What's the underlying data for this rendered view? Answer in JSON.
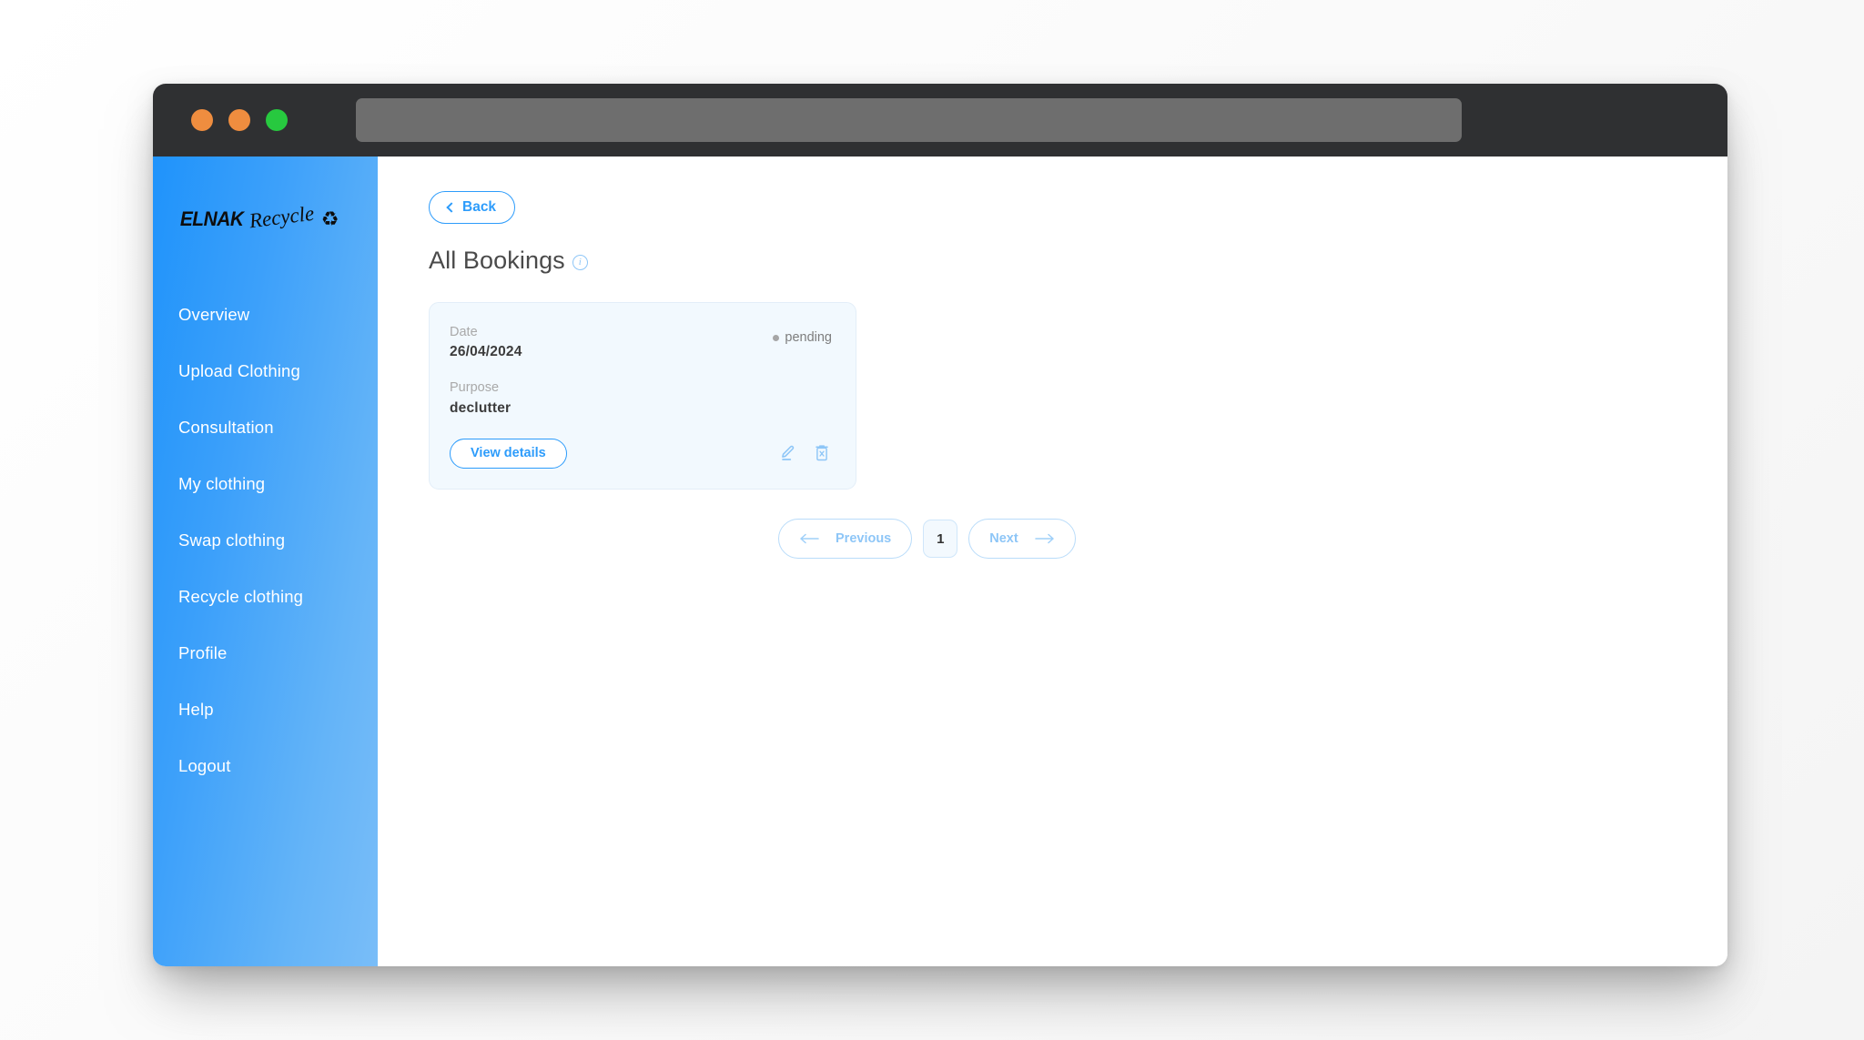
{
  "window": {
    "traffic_lights": [
      {
        "name": "close-button",
        "color": "#ef8d3f"
      },
      {
        "name": "minimize-button",
        "color": "#ef8d3f"
      },
      {
        "name": "zoom-button",
        "color": "#27c93f"
      }
    ],
    "address_bar": {
      "value": "",
      "placeholder": ""
    }
  },
  "sidebar": {
    "logo": {
      "brand": "ELNAK",
      "script": "Recycle",
      "symbol": "♻"
    },
    "items": [
      {
        "label": "Overview"
      },
      {
        "label": "Upload Clothing"
      },
      {
        "label": "Consultation"
      },
      {
        "label": "My clothing"
      },
      {
        "label": "Swap clothing"
      },
      {
        "label": "Recycle clothing"
      },
      {
        "label": "Profile"
      },
      {
        "label": "Help"
      },
      {
        "label": "Logout"
      }
    ]
  },
  "main": {
    "back_label": "Back",
    "page_title": "All Bookings",
    "info_icon_label": "i",
    "bookings": [
      {
        "date_label": "Date",
        "date_value": "26/04/2024",
        "purpose_label": "Purpose",
        "purpose_value": "declutter",
        "status": "pending",
        "view_details_label": "View details"
      }
    ],
    "pagination": {
      "previous_label": "Previous",
      "current_page": "1",
      "next_label": "Next"
    }
  },
  "colors": {
    "accent": "#2d9cfb",
    "sidebar_start": "#1f93fb",
    "sidebar_end": "#79bdf8",
    "card_bg": "#f2f9fe",
    "status_gray": "#a6a6a6",
    "muted_blue": "#8ec6f7"
  }
}
